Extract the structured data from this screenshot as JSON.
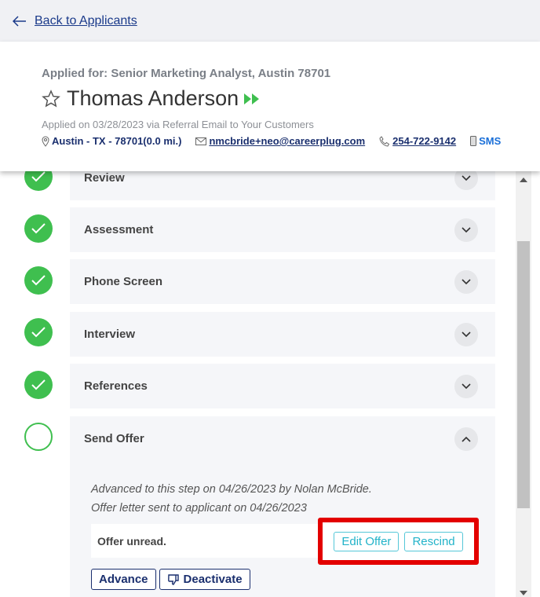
{
  "nav": {
    "back_label": "Back to Applicants",
    "back_icon": "arrow-left-icon"
  },
  "applicant": {
    "applied_for": "Applied for: Senior Marketing Analyst, Austin 78701",
    "name": "Thomas Anderson",
    "applied_on": "Applied on 03/28/2023 via Referral Email to Your Customers",
    "location": "Austin - TX - 78701(0.0 mi.)",
    "email": "nmcbride+neo@careerplug.com",
    "phone": "254-722-9142",
    "sms": "SMS"
  },
  "steps": [
    {
      "label": "Review",
      "done": true
    },
    {
      "label": "Assessment",
      "done": true
    },
    {
      "label": "Phone Screen",
      "done": true
    },
    {
      "label": "Interview",
      "done": true
    },
    {
      "label": "References",
      "done": true
    },
    {
      "label": "Send Offer",
      "done": false,
      "expanded": true
    }
  ],
  "offer": {
    "advanced_note": "Advanced to this step on 04/26/2023 by Nolan McBride.",
    "sent_note": "Offer letter sent to applicant on 04/26/2023",
    "status": "Offer unread.",
    "edit_label": "Edit Offer",
    "rescind_label": "Rescind",
    "advance_label": "Advance",
    "deactivate_label": "Deactivate"
  },
  "colors": {
    "success": "#3fbf4f",
    "navy": "#1a2f6e",
    "teal": "#22b3c9",
    "highlight": "#e30000"
  }
}
